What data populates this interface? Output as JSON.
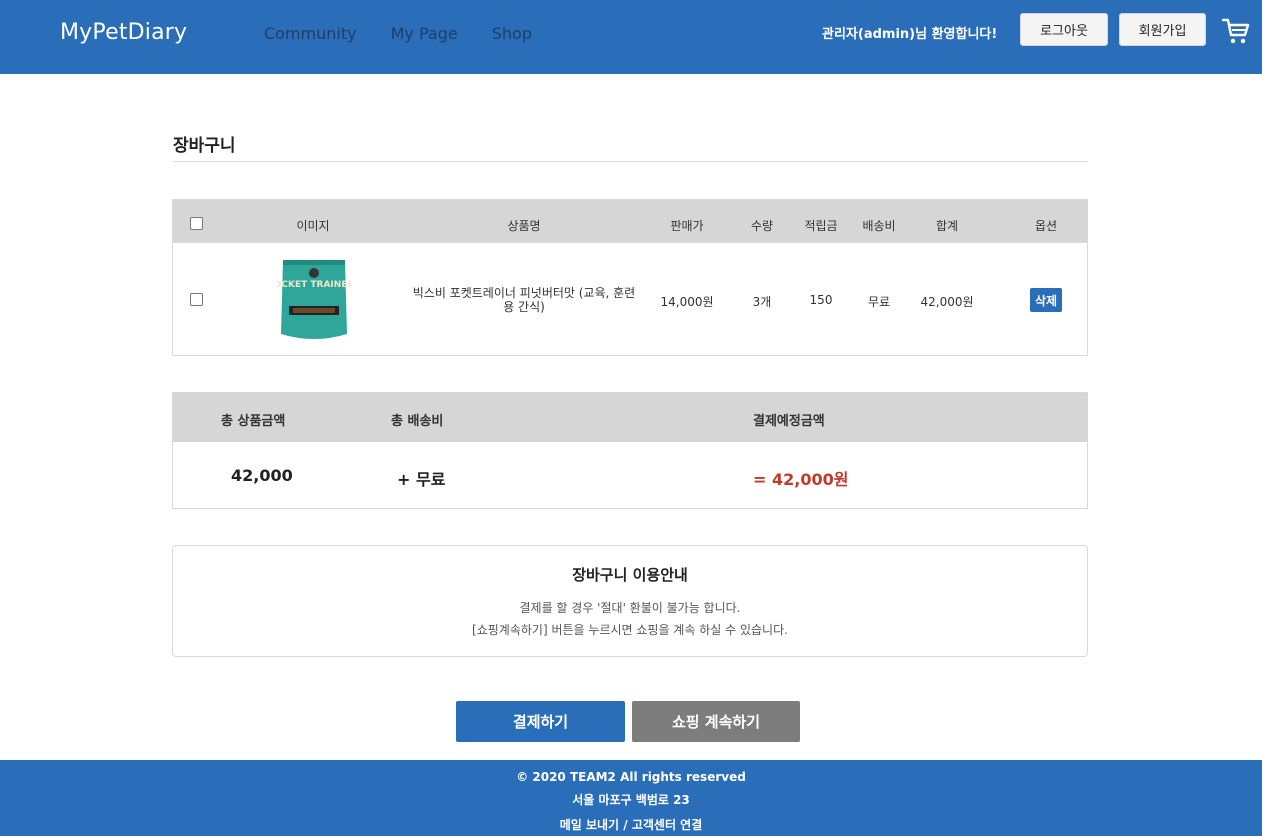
{
  "header": {
    "brand": "MyPetDiary",
    "nav": [
      "Community",
      "My Page",
      "Shop"
    ],
    "welcome": "관리자(admin)님 환영합니다!",
    "logout_label": "로그아웃",
    "signup_label": "회원가입",
    "cart_icon": "shopping-cart-icon"
  },
  "page_title": "장바구니",
  "cart": {
    "headers": {
      "image": "이미지",
      "name": "상품명",
      "price": "판매가",
      "qty": "수량",
      "points": "적립금",
      "shipping": "배송비",
      "total": "합계",
      "option": "옵션"
    },
    "items": [
      {
        "image_label": "POCKET TRAINERS",
        "name": "빅스비 포켓트레이너 피넛버터맛 (교육, 훈련용 간식)",
        "price": "14,000원",
        "qty": "3개",
        "points": "150",
        "shipping": "무료",
        "total": "42,000원",
        "delete_label": "삭제"
      }
    ]
  },
  "totals": {
    "product_label": "총 상품금액",
    "shipping_label": "총 배송비",
    "payment_label": "결제예정금액",
    "product_value": "42,000",
    "shipping_value": "+ 무료",
    "payment_value": "= 42,000원"
  },
  "notice": {
    "title": "장바구니 이용안내",
    "line1": "결제를 할 경우 '절대' 환불이 불가능 합니다.",
    "line2": "[쇼핑계속하기] 버튼을 누르시면 쇼핑을 계속 하실 수 있습니다."
  },
  "buttons": {
    "pay": "결제하기",
    "continue": "쇼핑 계속하기"
  },
  "footer": {
    "copyright": "© 2020 TEAM2 All rights reserved",
    "address": "서울 마포구 백범로 23",
    "contact": "메일 보내기 / 고객센터 연결"
  },
  "colors": {
    "primary": "#2a6db8",
    "header_gray": "#d6d6d6",
    "price_red": "#c0392b",
    "button_gray": "#7d7d7d"
  }
}
